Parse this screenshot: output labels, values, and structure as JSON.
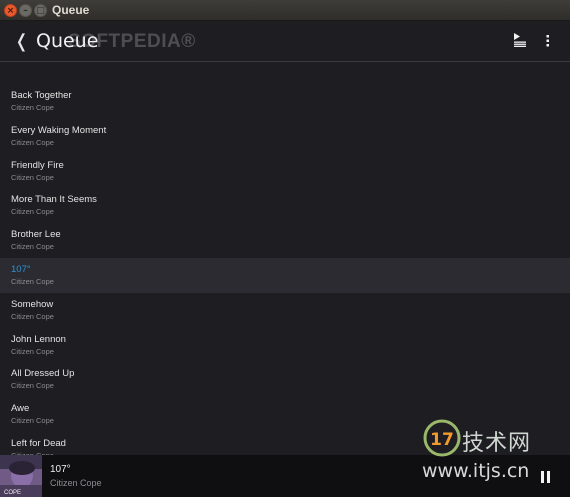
{
  "window": {
    "title": "Queue",
    "close_glyph": "×",
    "min_glyph": "–",
    "max_glyph": "□"
  },
  "header": {
    "back_glyph": "❬",
    "title": "Queue",
    "watermark": "SOFTPEDIA®",
    "icons": [
      "back-icon",
      "queue-icon",
      "menu-icon"
    ]
  },
  "queue": [
    {
      "title": "Back Together",
      "artist": "Citizen Cope"
    },
    {
      "title": "Every Waking Moment",
      "artist": "Citizen Cope"
    },
    {
      "title": "Friendly Fire",
      "artist": "Citizen Cope"
    },
    {
      "title": "More Than It Seems",
      "artist": "Citizen Cope"
    },
    {
      "title": "Brother Lee",
      "artist": "Citizen Cope"
    },
    {
      "title": "107°",
      "artist": "Citizen Cope",
      "active": true
    },
    {
      "title": "Somehow",
      "artist": "Citizen Cope"
    },
    {
      "title": "John Lennon",
      "artist": "Citizen Cope"
    },
    {
      "title": "All Dressed Up",
      "artist": "Citizen Cope"
    },
    {
      "title": "Awe",
      "artist": "Citizen Cope"
    },
    {
      "title": "Left for Dead",
      "artist": "Citizen Cope"
    }
  ],
  "now_playing": {
    "title": "107°",
    "artist": "Citizen Cope",
    "art_text": "COPE"
  },
  "site_watermark": {
    "logo_number": "17",
    "logo_text": "技术网",
    "url": "www.itjs.cn"
  },
  "colors": {
    "background": "#1d1d22",
    "active_row": "#2b2b31",
    "accent": "#2c94d6",
    "close_button": "#e9592d"
  }
}
